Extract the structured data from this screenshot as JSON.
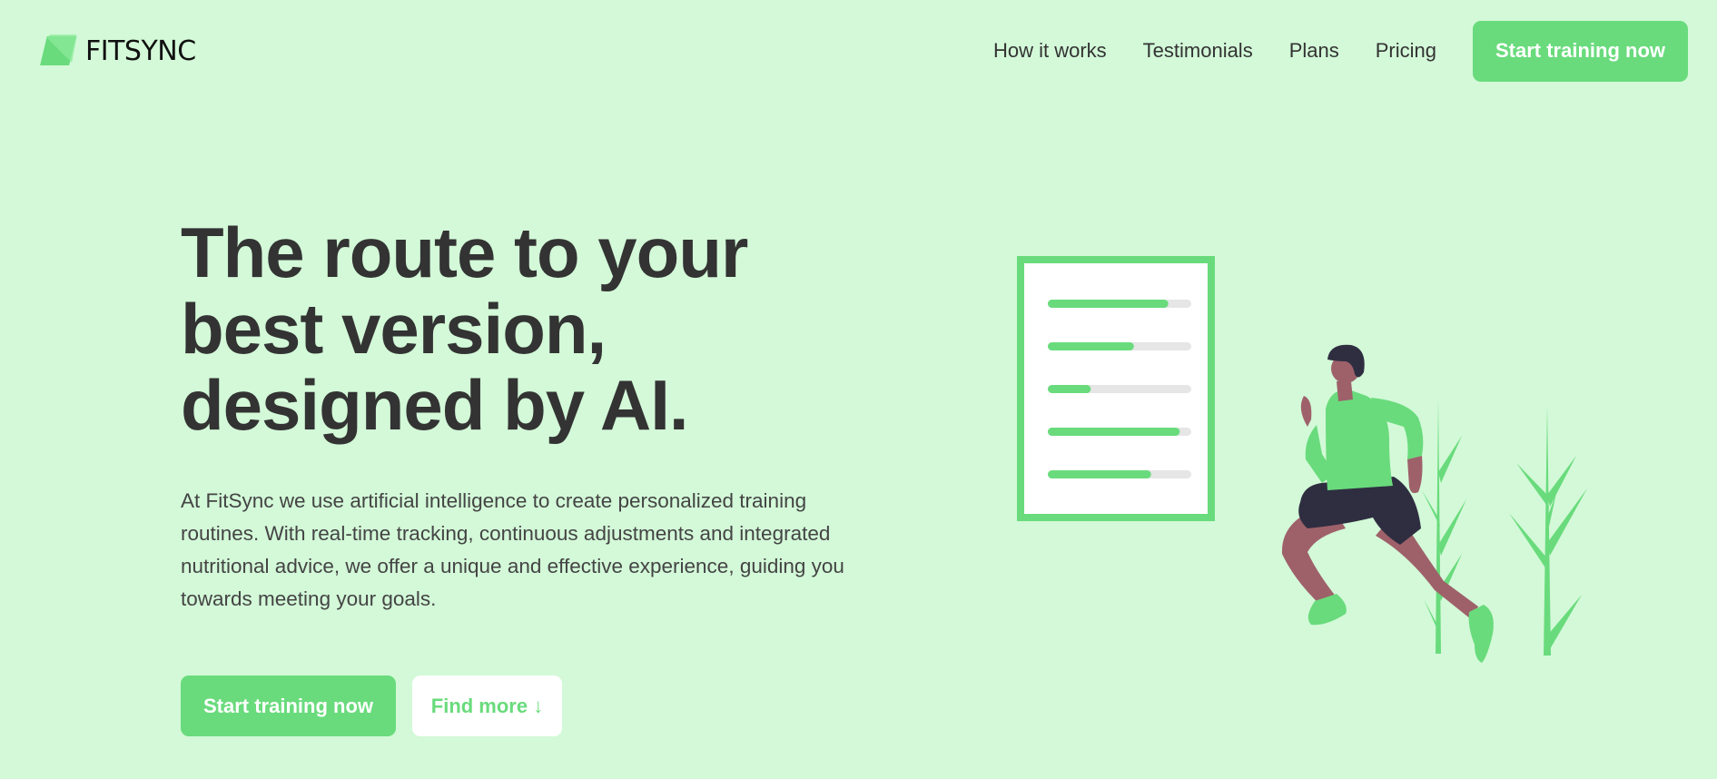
{
  "brand": {
    "name": "FITSYNC",
    "accent_color": "#69db7c",
    "background_color": "#d3f9d8",
    "text_color": "#333333"
  },
  "nav": {
    "links": [
      {
        "label": "How it works"
      },
      {
        "label": "Testimonials"
      },
      {
        "label": "Plans"
      },
      {
        "label": "Pricing"
      }
    ],
    "cta_label": "Start training now"
  },
  "hero": {
    "title": "The route to your best version, designed by AI.",
    "description": "At FitSync we use artificial intelligence to create personalized training routines. With real-time tracking, continuous adjustments and integrated nutritional advice, we offer a unique and effective experience, guiding you towards meeting your goals.",
    "primary_cta": "Start training now",
    "secondary_cta": "Find more ↓"
  },
  "illustration": {
    "icon": "runner-with-progress-board-illustration",
    "progress_bars": [
      0.84,
      0.6,
      0.3,
      0.92,
      0.72
    ]
  }
}
